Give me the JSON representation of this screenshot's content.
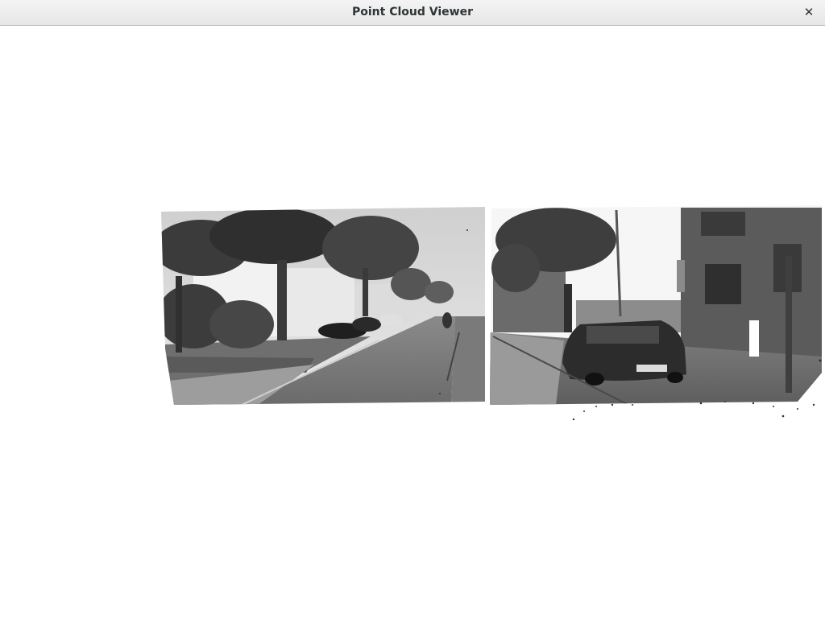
{
  "window": {
    "title": "Point Cloud Viewer",
    "close_glyph": "✕",
    "close_icon": "close-icon"
  },
  "viewport": {
    "background": "#ffffff",
    "scene": {
      "left_view": "street with trees, parked cars, white houses",
      "right_view": "parked dark car, building facade, trees"
    }
  },
  "colors": {
    "titlebar": "#ececec",
    "title_text": "#2e3436"
  }
}
